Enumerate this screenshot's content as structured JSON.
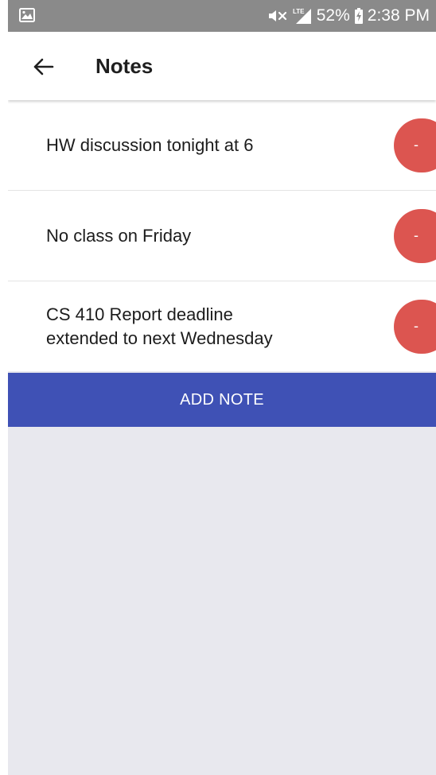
{
  "status_bar": {
    "battery": "52%",
    "time": "2:38 PM",
    "icons": [
      "image-icon",
      "mute-icon",
      "lte-signal-icon",
      "battery-charging-icon"
    ]
  },
  "toolbar": {
    "title": "Notes",
    "back_icon": "arrow-left-icon"
  },
  "notes": [
    {
      "text": "HW discussion tonight at 6",
      "remove_label": "-"
    },
    {
      "text": "No class on Friday",
      "remove_label": "-"
    },
    {
      "text": "CS 410 Report deadline\nextended to next Wednesday",
      "remove_label": "-"
    }
  ],
  "add_note_label": "ADD NOTE",
  "colors": {
    "status_bar": "#8a8a8a",
    "accent": "#3f51b5",
    "remove": "#dc5550",
    "background": "#e8e8ee"
  }
}
